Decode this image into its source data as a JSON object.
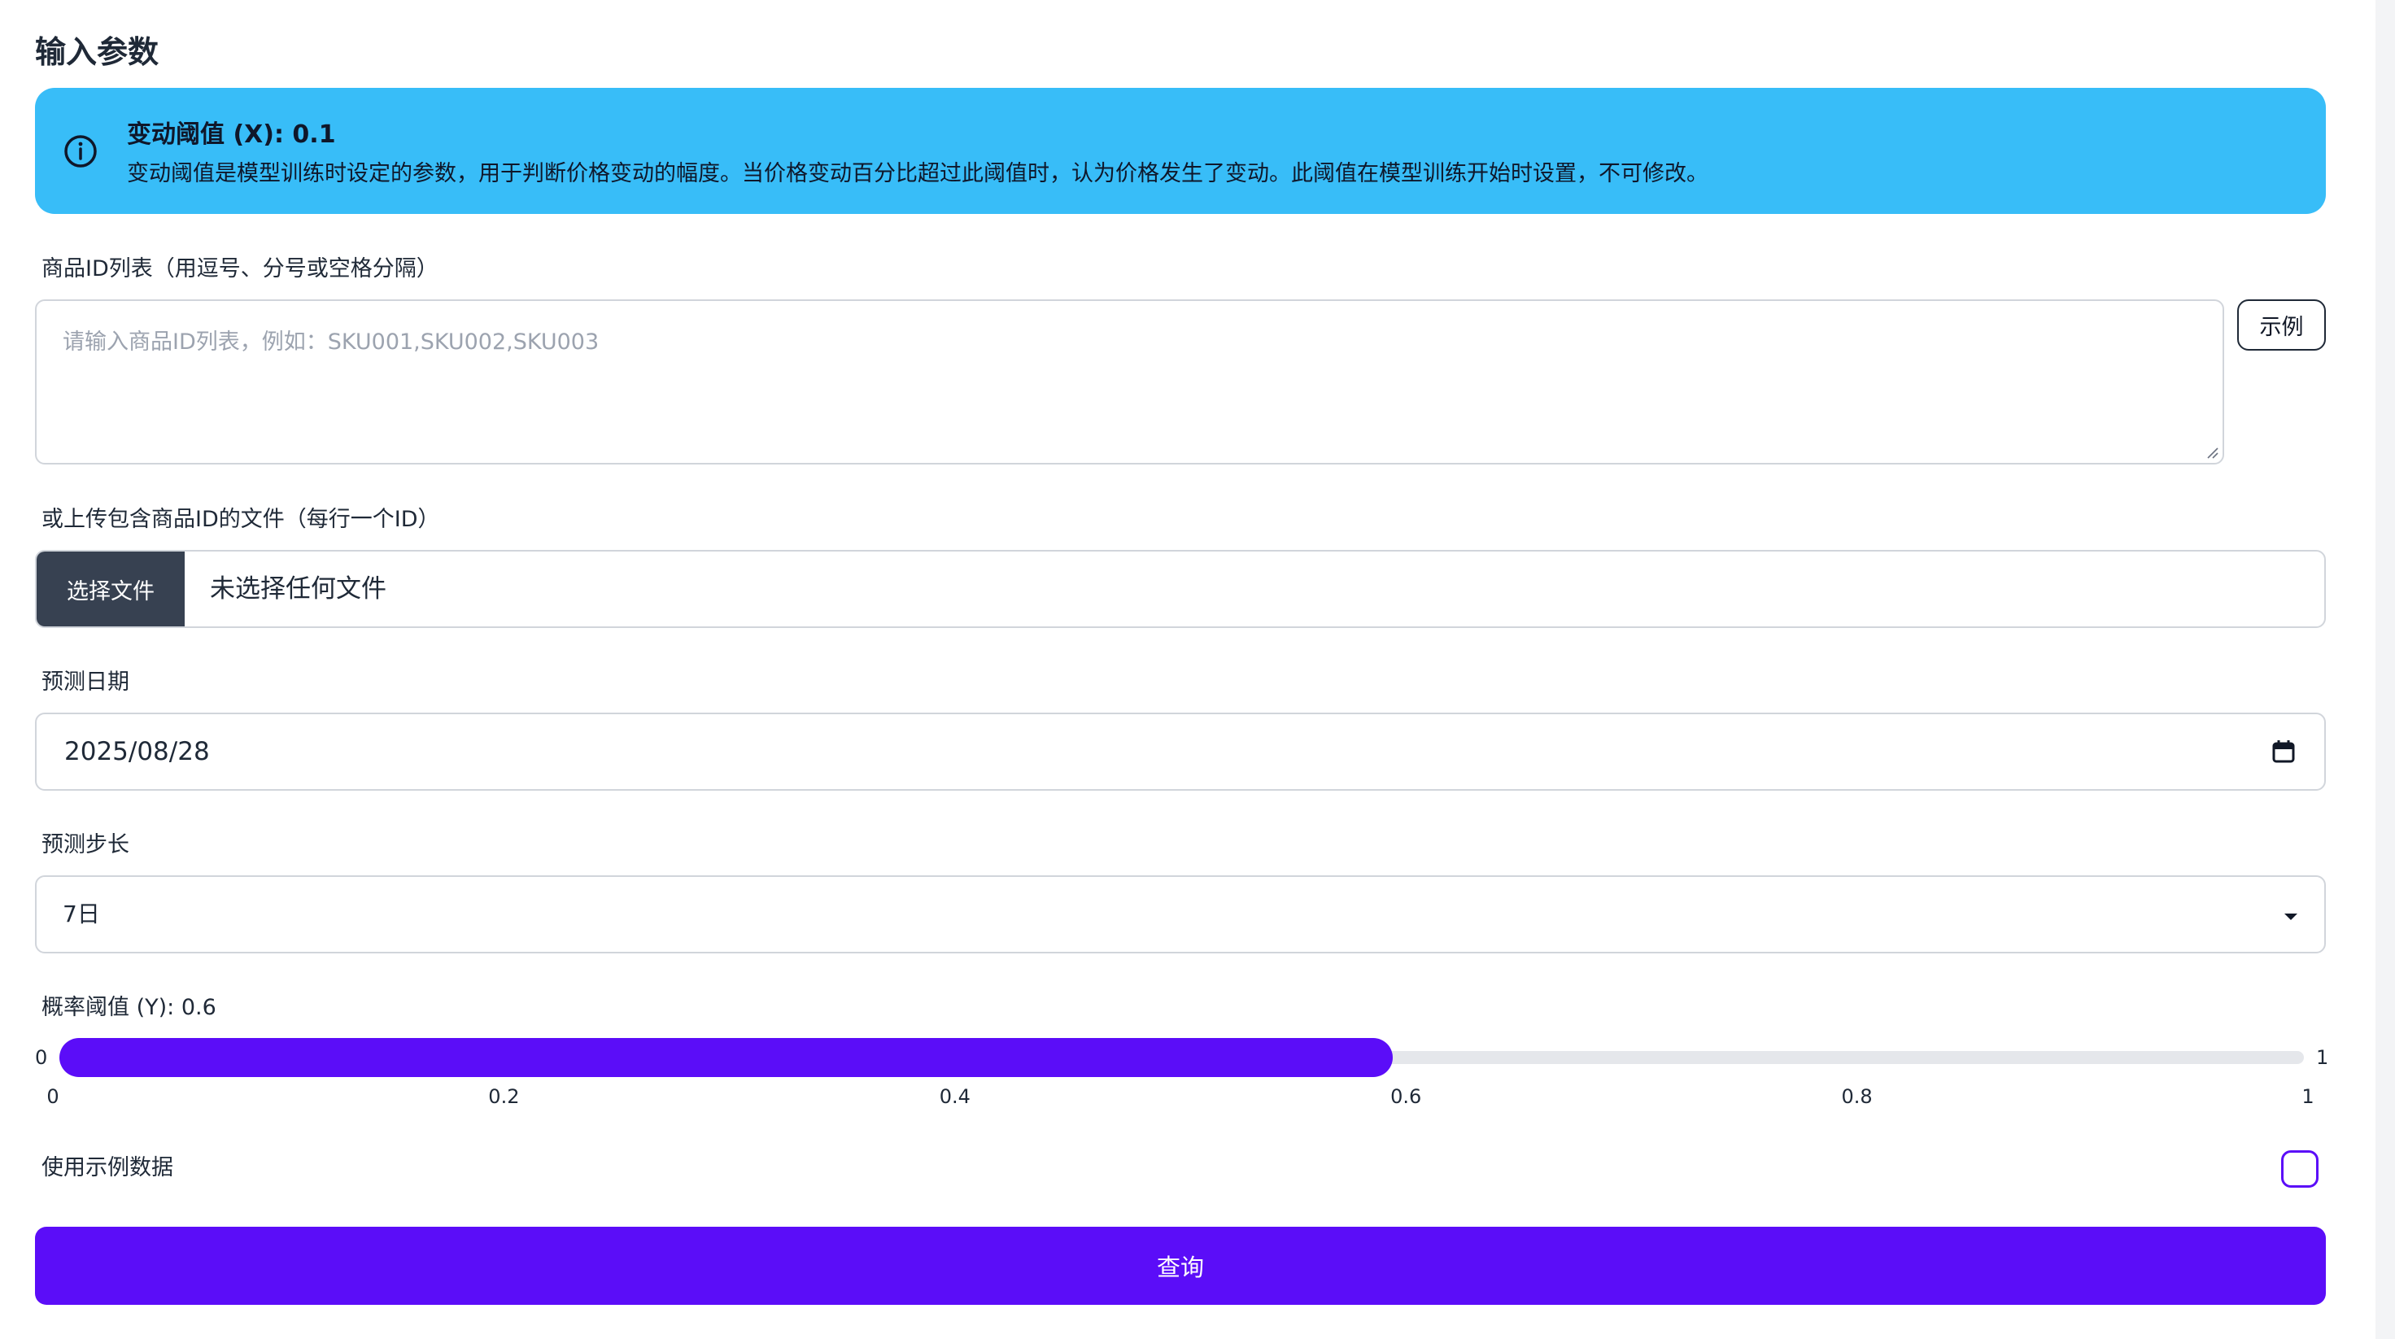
{
  "section": {
    "title": "输入参数"
  },
  "alert": {
    "icon": "info-circle-icon",
    "title": "变动阈值 (X): 0.1",
    "description": "变动阈值是模型训练时设定的参数，用于判断价格变动的幅度。当价格变动百分比超过此阈值时，认为价格发生了变动。此阈值在模型训练开始时设置，不可修改。"
  },
  "product_ids": {
    "label": "商品ID列表（用逗号、分号或空格分隔）",
    "placeholder": "请输入商品ID列表，例如：SKU001,SKU002,SKU003",
    "value": "",
    "example_button": "示例"
  },
  "file_upload": {
    "label": "或上传包含商品ID的文件（每行一个ID）",
    "button": "选择文件",
    "status": "未选择任何文件"
  },
  "forecast_date": {
    "label": "预测日期",
    "value": "2025/08/28",
    "icon": "calendar-icon"
  },
  "forecast_step": {
    "label": "预测步长",
    "selected": "7日",
    "icon": "chevron-down-icon"
  },
  "probability_threshold": {
    "label": "概率阈值 (Y): 0.6",
    "value": 0.6,
    "min_label": "0",
    "max_label": "1",
    "ticks": [
      "0",
      "0.2",
      "0.4",
      "0.6",
      "0.8",
      "1"
    ]
  },
  "use_example": {
    "label": "使用示例数据",
    "checked": false
  },
  "submit": {
    "label": "查询"
  },
  "colors": {
    "accent": "#5b0df8",
    "alert_bg": "#38bdf8",
    "file_button_bg": "#374151",
    "border": "#d1d5db"
  }
}
